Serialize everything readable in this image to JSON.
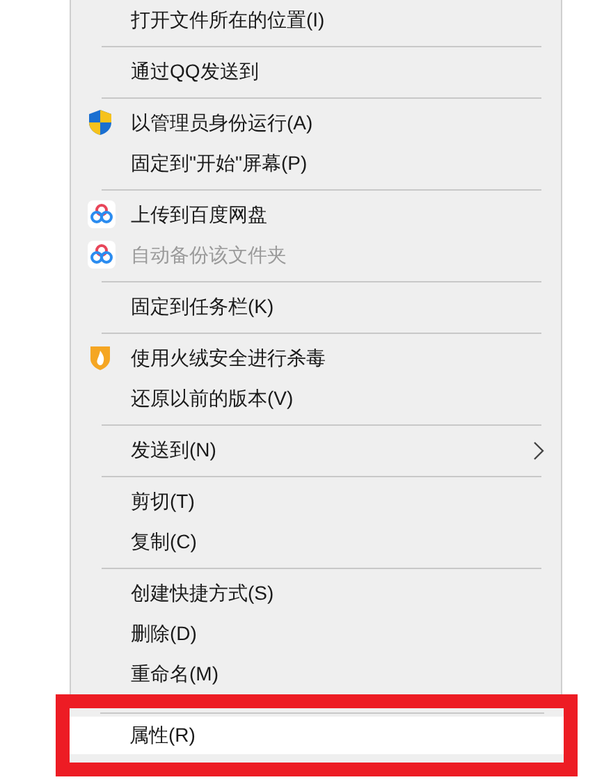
{
  "menu": {
    "items": [
      {
        "kind": "item",
        "label": "打开文件所在的位置(I)",
        "disabled": false,
        "selected": false
      },
      {
        "kind": "separator"
      },
      {
        "kind": "item",
        "label": "通过QQ发送到",
        "disabled": false,
        "selected": false
      },
      {
        "kind": "separator"
      },
      {
        "kind": "shield",
        "label": "以管理员身份运行(A)",
        "disabled": false,
        "selected": false
      },
      {
        "kind": "item",
        "label": "固定到\"开始\"屏幕(P)",
        "disabled": false,
        "selected": false
      },
      {
        "kind": "separator"
      },
      {
        "kind": "cloud",
        "label": "上传到百度网盘",
        "disabled": false,
        "selected": false
      },
      {
        "kind": "cloud",
        "label": "自动备份该文件夹",
        "disabled": true,
        "selected": false
      },
      {
        "kind": "separator"
      },
      {
        "kind": "item",
        "label": "固定到任务栏(K)",
        "disabled": false,
        "selected": false
      },
      {
        "kind": "separator"
      },
      {
        "kind": "flame",
        "label": "使用火绒安全进行杀毒",
        "disabled": false,
        "selected": false
      },
      {
        "kind": "item",
        "label": "还原以前的版本(V)",
        "disabled": false,
        "selected": false
      },
      {
        "kind": "separator"
      },
      {
        "kind": "submenu",
        "label": "发送到(N)",
        "disabled": false,
        "selected": false
      },
      {
        "kind": "separator"
      },
      {
        "kind": "item",
        "label": "剪切(T)",
        "disabled": false,
        "selected": false
      },
      {
        "kind": "item",
        "label": "复制(C)",
        "disabled": false,
        "selected": false
      },
      {
        "kind": "separator"
      },
      {
        "kind": "item",
        "label": "创建快捷方式(S)",
        "disabled": false,
        "selected": false
      },
      {
        "kind": "item",
        "label": "删除(D)",
        "disabled": false,
        "selected": false
      },
      {
        "kind": "item",
        "label": "重命名(M)",
        "disabled": false,
        "selected": false
      },
      {
        "kind": "separator"
      },
      {
        "kind": "item",
        "label": "属性(R)",
        "disabled": false,
        "selected": true,
        "highlighted": true
      }
    ]
  }
}
